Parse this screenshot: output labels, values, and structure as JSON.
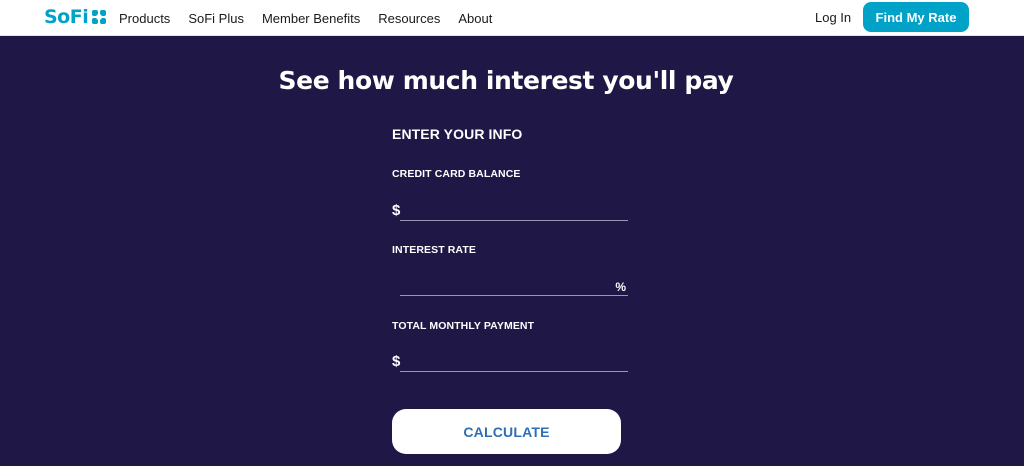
{
  "nav": {
    "logo_text": "SoFi",
    "links": [
      "Products",
      "SoFi Plus",
      "Member Benefits",
      "Resources",
      "About"
    ],
    "login_label": "Log In",
    "cta_label": "Find My Rate"
  },
  "hero": {
    "title": "See how much interest you'll pay"
  },
  "form": {
    "heading": "ENTER YOUR INFO",
    "balance": {
      "label": "CREDIT CARD BALANCE",
      "prefix": "$",
      "value": ""
    },
    "rate": {
      "label": "INTEREST RATE",
      "suffix": "%",
      "value": ""
    },
    "payment": {
      "label": "TOTAL MONTHLY PAYMENT",
      "prefix": "$",
      "value": ""
    },
    "submit_label": "CALCULATE"
  },
  "colors": {
    "brand": "#00a2c7",
    "background": "#1f1746",
    "button_text": "#2e6fb2"
  }
}
